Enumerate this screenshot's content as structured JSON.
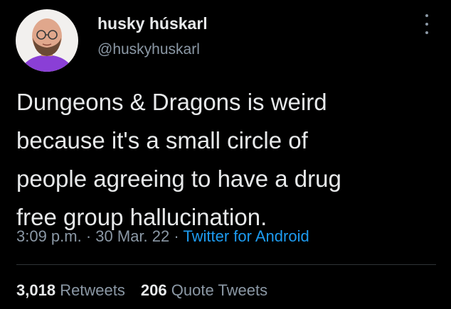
{
  "author": {
    "display_name": "husky húskarl",
    "handle": "@huskyhuskarl"
  },
  "tweet": {
    "text_lines": [
      "Dungeons & Dragons is weird",
      "because it's a small circle of",
      "people agreeing to have a drug",
      "free group hallucination."
    ]
  },
  "meta": {
    "time": "3:09 p.m.",
    "separator1": " · ",
    "date": "30 Mar. 22",
    "separator2": " · ",
    "source": "Twitter for Android"
  },
  "stats": {
    "retweets_count": "3,018",
    "retweets_label": "Retweets",
    "quotes_count": "206",
    "quotes_label": "Quote Tweets"
  },
  "icons": {
    "more": "more-options-icon",
    "avatar": "profile-avatar"
  },
  "colors": {
    "background": "#000000",
    "primary_text": "#e7e9ea",
    "secondary_text": "#8b98a5",
    "link": "#1d9bf0",
    "divider": "#2f3336",
    "avatar_shirt": "#8a3fd6",
    "avatar_bg": "#f2f0ee"
  }
}
